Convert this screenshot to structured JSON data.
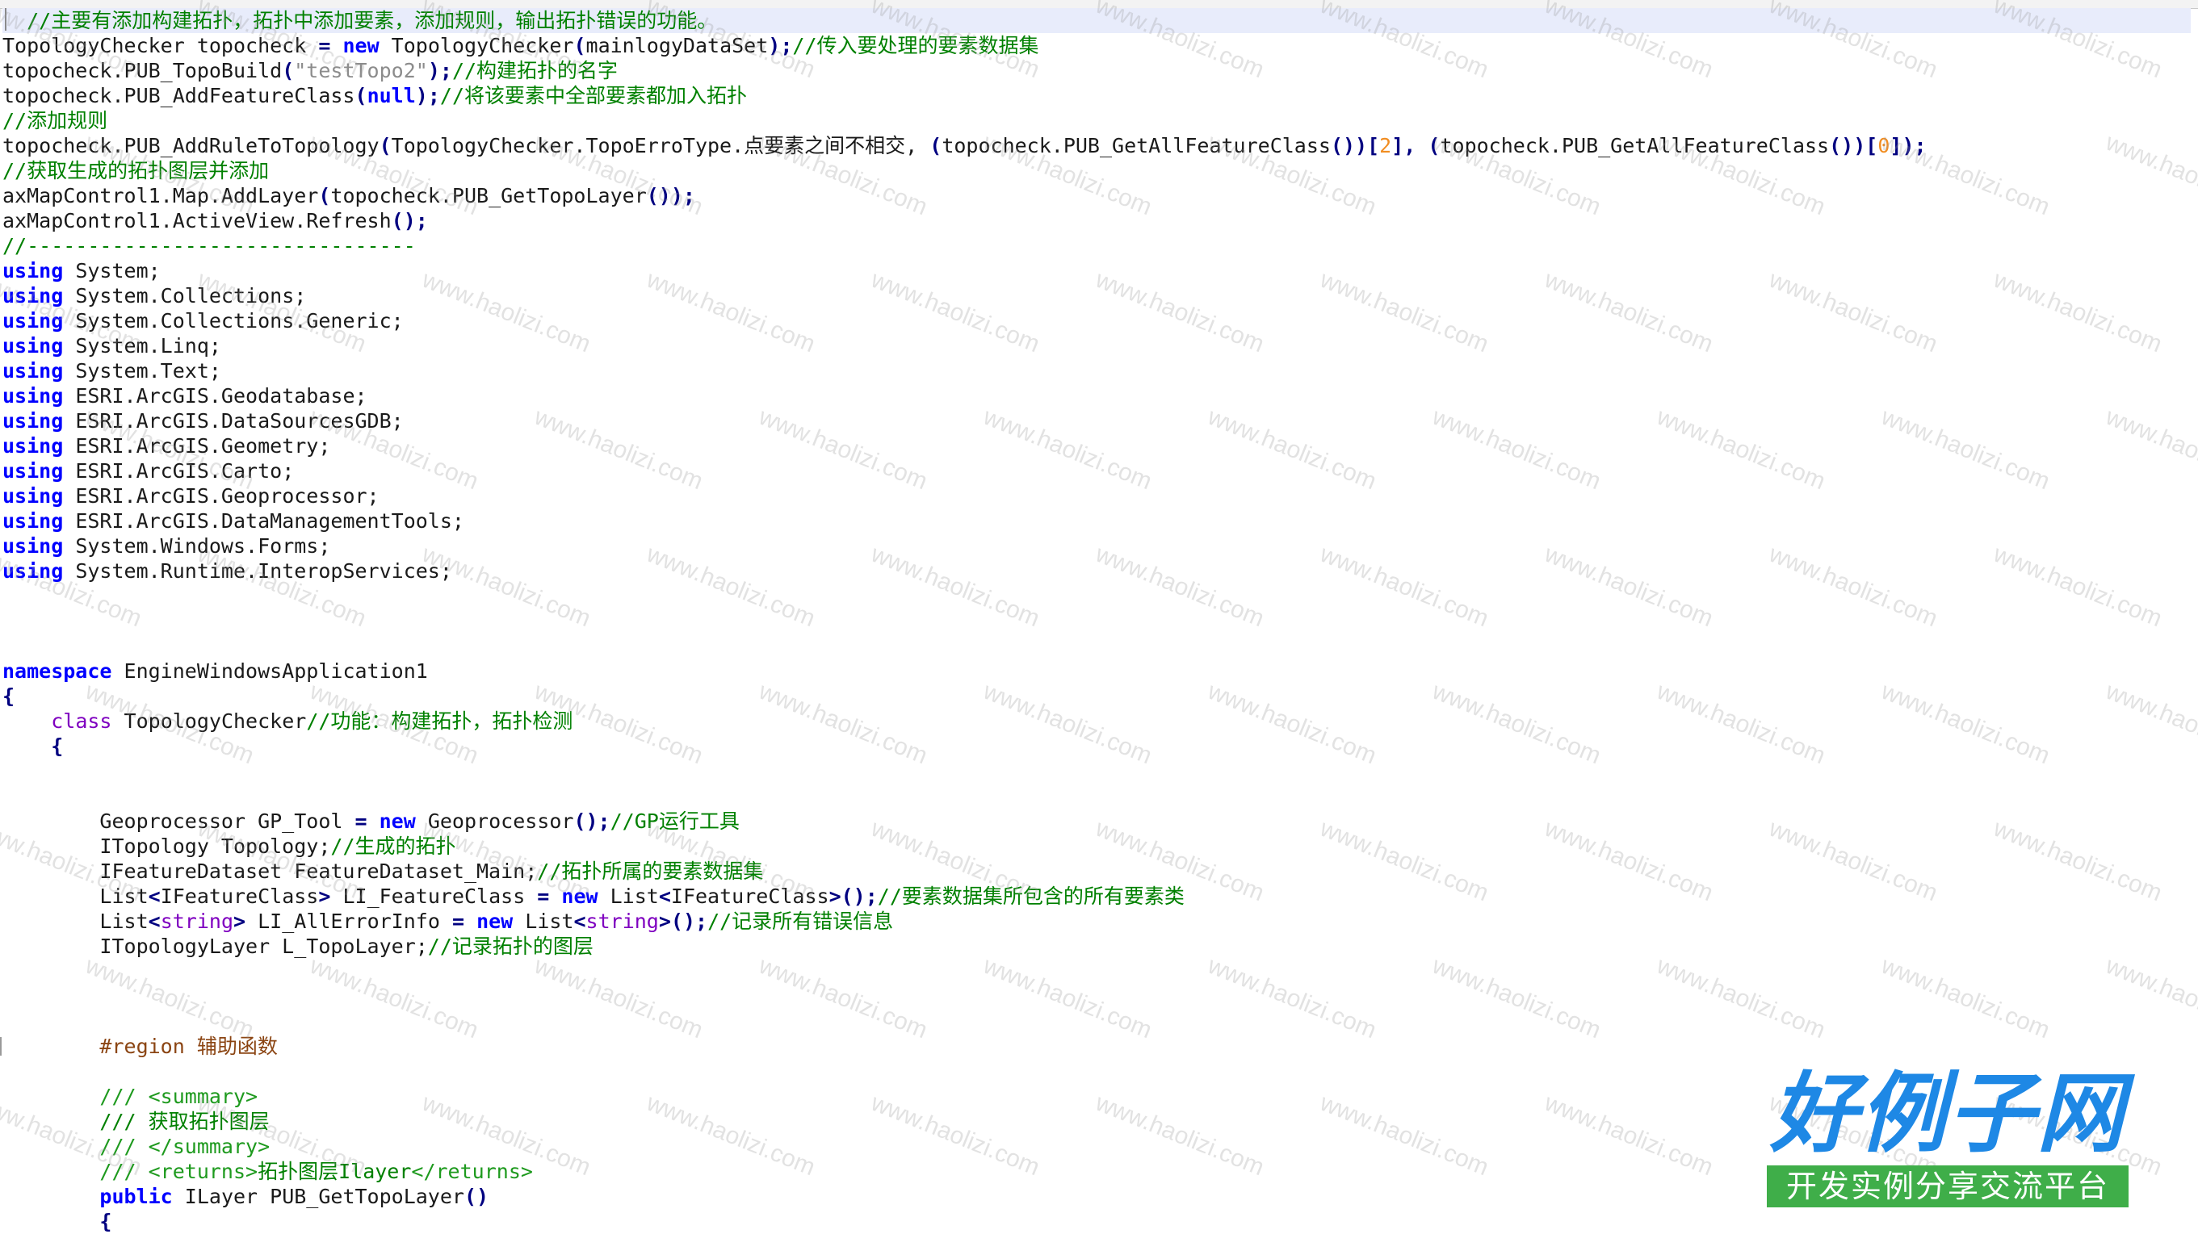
{
  "editor": {
    "lines": [
      [
        {
          "c": "cm",
          "t": "  //主要有添加构建拓扑，拓扑中添加要素，添加规则，输出拓扑错误的功能。"
        }
      ],
      [
        {
          "c": "tk",
          "t": "TopologyChecker topocheck "
        },
        {
          "c": "pun",
          "t": "="
        },
        {
          "c": "tk",
          "t": " "
        },
        {
          "c": "kw",
          "t": "new"
        },
        {
          "c": "tk",
          "t": " TopologyChecker"
        },
        {
          "c": "pun",
          "t": "("
        },
        {
          "c": "tk",
          "t": "mainlogyDataSet"
        },
        {
          "c": "pun",
          "t": ");"
        },
        {
          "c": "cm",
          "t": "//传入要处理的要素数据集"
        }
      ],
      [
        {
          "c": "tk",
          "t": "topocheck.PUB_TopoBuild"
        },
        {
          "c": "pun",
          "t": "("
        },
        {
          "c": "str",
          "t": "\"testTopo2\""
        },
        {
          "c": "pun",
          "t": ");"
        },
        {
          "c": "cm",
          "t": "//构建拓扑的名字"
        }
      ],
      [
        {
          "c": "tk",
          "t": "topocheck.PUB_AddFeatureClass"
        },
        {
          "c": "pun",
          "t": "("
        },
        {
          "c": "kw",
          "t": "null"
        },
        {
          "c": "pun",
          "t": ");"
        },
        {
          "c": "cm",
          "t": "//将该要素中全部要素都加入拓扑"
        }
      ],
      [
        {
          "c": "cm",
          "t": "//添加规则"
        }
      ],
      [
        {
          "c": "tk",
          "t": "topocheck.PUB_AddRuleToTopology"
        },
        {
          "c": "pun",
          "t": "("
        },
        {
          "c": "tk",
          "t": "TopologyChecker.TopoErroType.点要素之间不相交, "
        },
        {
          "c": "pun",
          "t": "("
        },
        {
          "c": "tk",
          "t": "topocheck.PUB_GetAllFeatureClass"
        },
        {
          "c": "pun",
          "t": "())["
        },
        {
          "c": "num",
          "t": "2"
        },
        {
          "c": "pun",
          "t": "],"
        },
        {
          "c": "tk",
          "t": " "
        },
        {
          "c": "pun",
          "t": "("
        },
        {
          "c": "tk",
          "t": "topocheck.PUB_GetAllFeatureClass"
        },
        {
          "c": "pun",
          "t": "())["
        },
        {
          "c": "num",
          "t": "0"
        },
        {
          "c": "pun",
          "t": "]);"
        }
      ],
      [
        {
          "c": "cm",
          "t": "//获取生成的拓扑图层并添加"
        }
      ],
      [
        {
          "c": "tk",
          "t": "axMapControl1.Map.AddLayer"
        },
        {
          "c": "pun",
          "t": "("
        },
        {
          "c": "tk",
          "t": "topocheck.PUB_GetTopoLayer"
        },
        {
          "c": "pun",
          "t": "());"
        }
      ],
      [
        {
          "c": "tk",
          "t": "axMapControl1.ActiveView.Refresh"
        },
        {
          "c": "pun",
          "t": "();"
        }
      ],
      [
        {
          "c": "cm",
          "t": "//--------------------------------"
        }
      ],
      [
        {
          "c": "kw",
          "t": "using"
        },
        {
          "c": "tk",
          "t": " System;"
        }
      ],
      [
        {
          "c": "kw",
          "t": "using"
        },
        {
          "c": "tk",
          "t": " System.Collections;"
        }
      ],
      [
        {
          "c": "kw",
          "t": "using"
        },
        {
          "c": "tk",
          "t": " System.Collections.Generic;"
        }
      ],
      [
        {
          "c": "kw",
          "t": "using"
        },
        {
          "c": "tk",
          "t": " System.Linq;"
        }
      ],
      [
        {
          "c": "kw",
          "t": "using"
        },
        {
          "c": "tk",
          "t": " System.Text;"
        }
      ],
      [
        {
          "c": "kw",
          "t": "using"
        },
        {
          "c": "tk",
          "t": " ESRI.ArcGIS.Geodatabase;"
        }
      ],
      [
        {
          "c": "kw",
          "t": "using"
        },
        {
          "c": "tk",
          "t": " ESRI.ArcGIS.DataSourcesGDB;"
        }
      ],
      [
        {
          "c": "kw",
          "t": "using"
        },
        {
          "c": "tk",
          "t": " ESRI.ArcGIS.Geometry;"
        }
      ],
      [
        {
          "c": "kw",
          "t": "using"
        },
        {
          "c": "tk",
          "t": " ESRI.ArcGIS.Carto;"
        }
      ],
      [
        {
          "c": "kw",
          "t": "using"
        },
        {
          "c": "tk",
          "t": " ESRI.ArcGIS.Geoprocessor;"
        }
      ],
      [
        {
          "c": "kw",
          "t": "using"
        },
        {
          "c": "tk",
          "t": " ESRI.ArcGIS.DataManagementTools;"
        }
      ],
      [
        {
          "c": "kw",
          "t": "using"
        },
        {
          "c": "tk",
          "t": " System.Windows.Forms;"
        }
      ],
      [
        {
          "c": "kw",
          "t": "using"
        },
        {
          "c": "tk",
          "t": " System.Runtime.InteropServices;"
        }
      ],
      [],
      [],
      [],
      [
        {
          "c": "kw",
          "t": "namespace"
        },
        {
          "c": "tk",
          "t": " EngineWindowsApplication1"
        }
      ],
      [
        {
          "c": "pun",
          "t": "{"
        }
      ],
      [
        {
          "c": "tk",
          "t": "    "
        },
        {
          "c": "kw2",
          "t": "class"
        },
        {
          "c": "tk",
          "t": " TopologyChecker"
        },
        {
          "c": "cm",
          "t": "//功能：构建拓扑，拓扑检测"
        }
      ],
      [
        {
          "c": "tk",
          "t": "    "
        },
        {
          "c": "pun",
          "t": "{"
        }
      ],
      [],
      [],
      [
        {
          "c": "tk",
          "t": "        Geoprocessor GP_Tool "
        },
        {
          "c": "pun",
          "t": "="
        },
        {
          "c": "tk",
          "t": " "
        },
        {
          "c": "kw",
          "t": "new"
        },
        {
          "c": "tk",
          "t": " Geoprocessor"
        },
        {
          "c": "pun",
          "t": "();"
        },
        {
          "c": "cm",
          "t": "//GP运行工具"
        }
      ],
      [
        {
          "c": "tk",
          "t": "        ITopology Topology;"
        },
        {
          "c": "cm",
          "t": "//生成的拓扑"
        }
      ],
      [
        {
          "c": "tk",
          "t": "        IFeatureDataset FeatureDataset_Main;"
        },
        {
          "c": "cm",
          "t": "//拓扑所属的要素数据集"
        }
      ],
      [
        {
          "c": "tk",
          "t": "        List"
        },
        {
          "c": "pun",
          "t": "<"
        },
        {
          "c": "tk",
          "t": "IFeatureClass"
        },
        {
          "c": "pun",
          "t": ">"
        },
        {
          "c": "tk",
          "t": " LI_FeatureClass "
        },
        {
          "c": "pun",
          "t": "="
        },
        {
          "c": "tk",
          "t": " "
        },
        {
          "c": "kw",
          "t": "new"
        },
        {
          "c": "tk",
          "t": " List"
        },
        {
          "c": "pun",
          "t": "<"
        },
        {
          "c": "tk",
          "t": "IFeatureClass"
        },
        {
          "c": "pun",
          "t": ">();"
        },
        {
          "c": "cm",
          "t": "//要素数据集所包含的所有要素类"
        }
      ],
      [
        {
          "c": "tk",
          "t": "        List"
        },
        {
          "c": "pun",
          "t": "<"
        },
        {
          "c": "kw2",
          "t": "string"
        },
        {
          "c": "pun",
          "t": ">"
        },
        {
          "c": "tk",
          "t": " LI_AllErrorInfo "
        },
        {
          "c": "pun",
          "t": "="
        },
        {
          "c": "tk",
          "t": " "
        },
        {
          "c": "kw",
          "t": "new"
        },
        {
          "c": "tk",
          "t": " List"
        },
        {
          "c": "pun",
          "t": "<"
        },
        {
          "c": "kw2",
          "t": "string"
        },
        {
          "c": "pun",
          "t": ">();"
        },
        {
          "c": "cm",
          "t": "//记录所有错误信息"
        }
      ],
      [
        {
          "c": "tk",
          "t": "        ITopologyLayer L_TopoLayer;"
        },
        {
          "c": "cm",
          "t": "//记录拓扑的图层"
        }
      ],
      [],
      [],
      [],
      [
        {
          "c": "tk",
          "t": "        "
        },
        {
          "c": "pp",
          "t": "#region 辅助函数"
        }
      ],
      [],
      [
        {
          "c": "tk",
          "t": "        "
        },
        {
          "c": "cmd",
          "t": "/// <summary>"
        }
      ],
      [
        {
          "c": "tk",
          "t": "        "
        },
        {
          "c": "cm",
          "t": "/// 获取拓扑图层"
        }
      ],
      [
        {
          "c": "tk",
          "t": "        "
        },
        {
          "c": "cmd",
          "t": "/// </summary>"
        }
      ],
      [
        {
          "c": "tk",
          "t": "        "
        },
        {
          "c": "cmd",
          "t": "/// <returns>"
        },
        {
          "c": "cm",
          "t": "拓扑图层Ilayer"
        },
        {
          "c": "cmd",
          "t": "</returns>"
        }
      ],
      [
        {
          "c": "tk",
          "t": "        "
        },
        {
          "c": "kw",
          "t": "public"
        },
        {
          "c": "tk",
          "t": " ILayer PUB_GetTopoLayer"
        },
        {
          "c": "pun",
          "t": "()"
        }
      ],
      [
        {
          "c": "tk",
          "t": "        "
        },
        {
          "c": "pun",
          "t": "{"
        }
      ]
    ]
  },
  "watermark": {
    "text": "www.haolizi.com"
  },
  "logo": {
    "title": "好例子网",
    "subtitle": "开发实例分享交流平台",
    "title_color": "#1e88e5",
    "subtitle_bg": "#3fae49"
  }
}
